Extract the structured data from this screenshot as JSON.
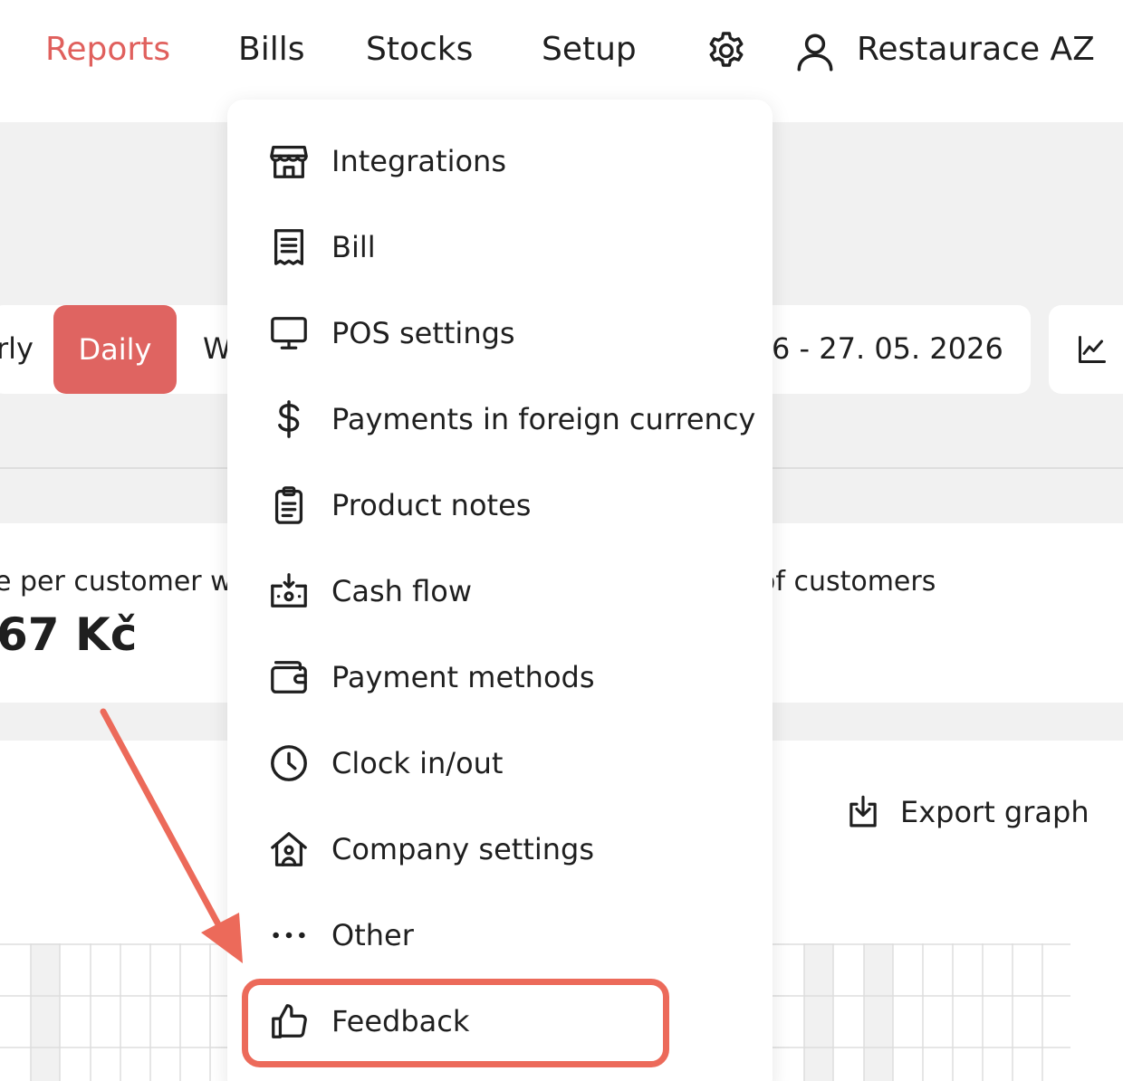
{
  "nav": {
    "reports": "Reports",
    "bills": "Bills",
    "stocks": "Stocks",
    "setup": "Setup",
    "account_name": "Restaurace AZ"
  },
  "period_tabs": {
    "yearly_partial": "rly",
    "daily": "Daily",
    "weekly_partial": "W"
  },
  "date_range_partial": "6 - 27. 05. 2026",
  "stats": {
    "per_customer_label_partial": "e per customer w",
    "per_customer_value_partial": "67 Kč",
    "customers_label_partial": "of customers"
  },
  "chart": {
    "export_label": "Export graph"
  },
  "settings_menu": [
    {
      "label": "Integrations",
      "icon": "store-icon"
    },
    {
      "label": "Bill",
      "icon": "receipt-icon"
    },
    {
      "label": "POS settings",
      "icon": "monitor-icon"
    },
    {
      "label": "Payments in foreign currency",
      "icon": "dollar-icon"
    },
    {
      "label": "Product notes",
      "icon": "clipboard-icon"
    },
    {
      "label": "Cash flow",
      "icon": "cash-register-icon"
    },
    {
      "label": "Payment methods",
      "icon": "wallet-icon"
    },
    {
      "label": "Clock in/out",
      "icon": "clock-icon"
    },
    {
      "label": "Company settings",
      "icon": "company-house-icon"
    },
    {
      "label": "Other",
      "icon": "more-dots-icon"
    },
    {
      "label": "Feedback",
      "icon": "thumbs-up-icon"
    }
  ],
  "colors": {
    "accent": "#e0605d",
    "highlight": "#ec6a5a"
  }
}
